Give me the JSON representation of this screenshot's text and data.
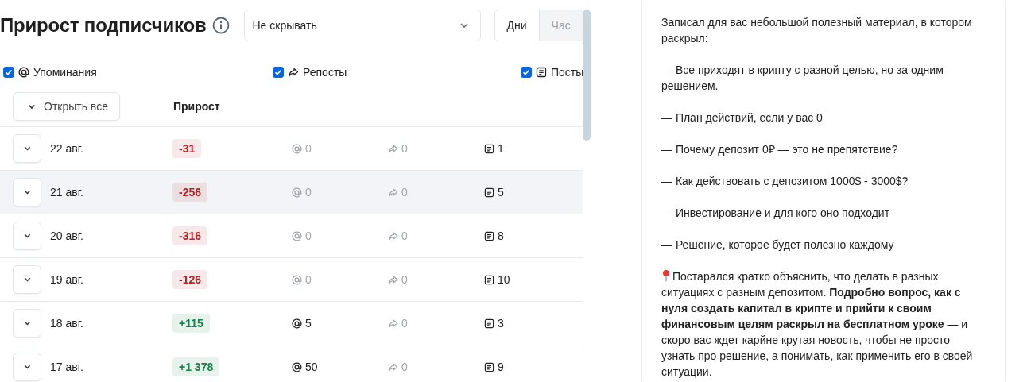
{
  "header": {
    "title": "Прирост подписчиков",
    "filter": {
      "value": "Не скрывать"
    },
    "periods": [
      {
        "label": "Дни",
        "selected": true
      },
      {
        "label": "Час",
        "selected": false
      }
    ]
  },
  "toggles": [
    {
      "label": "Упоминания",
      "checked": true,
      "kind": "mention"
    },
    {
      "label": "Репосты",
      "checked": true,
      "kind": "repost"
    },
    {
      "label": "Посты",
      "checked": true,
      "kind": "post"
    }
  ],
  "table": {
    "expand_all": "Открыть все",
    "columns": [
      "Прирост"
    ],
    "rows": [
      {
        "date": "22 авг.",
        "growth": "-31",
        "color": "#b42323",
        "mentions": {
          "text": "0",
          "dim": true
        },
        "reposts": {
          "text": "0",
          "dim": true
        },
        "posts": {
          "text": "1",
          "dim": false
        },
        "highlighted": false
      },
      {
        "date": "21 авг.",
        "growth": "-256",
        "color": "#b42323",
        "mentions": {
          "text": "0",
          "dim": true
        },
        "reposts": {
          "text": "0",
          "dim": true
        },
        "posts": {
          "text": "5",
          "dim": false
        },
        "highlighted": true
      },
      {
        "date": "20 авг.",
        "growth": "-316",
        "color": "#b42323",
        "mentions": {
          "text": "0",
          "dim": true
        },
        "reposts": {
          "text": "0",
          "dim": true
        },
        "posts": {
          "text": "8",
          "dim": false
        },
        "highlighted": false
      },
      {
        "date": "19 авг.",
        "growth": "-126",
        "color": "#b42323",
        "mentions": {
          "text": "0",
          "dim": true
        },
        "reposts": {
          "text": "0",
          "dim": true
        },
        "posts": {
          "text": "10",
          "dim": false
        },
        "highlighted": false
      },
      {
        "date": "18 авг.",
        "growth": "+115",
        "color": "#14804a",
        "mentions": {
          "text": "5",
          "dim": false
        },
        "reposts": {
          "text": "0",
          "dim": true
        },
        "posts": {
          "text": "3",
          "dim": false
        },
        "highlighted": false
      },
      {
        "date": "17 авг.",
        "growth": "+1 378",
        "color": "#14804a",
        "mentions": {
          "text": "50",
          "dim": false
        },
        "reposts": {
          "text": "0",
          "dim": true
        },
        "posts": {
          "text": "9",
          "dim": false
        },
        "highlighted": false
      }
    ]
  },
  "post": {
    "paragraphs": [
      {
        "text": "Записал для вас небольшой полезный материал, в котором раскрыл:",
        "pinned": false
      },
      {
        "text": "— Все приходят в крипту с разной целью, но за одним решением.",
        "pinned": false
      },
      {
        "text": "— План действий, если у вас 0",
        "pinned": false
      },
      {
        "text": "— Почему депозит 0₽ — это не препятствие?",
        "pinned": false
      },
      {
        "text": "— Как действовать с депозитом 1000$ - 3000$?",
        "pinned": false
      },
      {
        "text": "— Инвестирование и для кого оно подходит",
        "pinned": false
      },
      {
        "text": "— Решение, которое будет полезно каждому",
        "pinned": false
      },
      {
        "text": "Постарался кратко объяснить, что делать в разных ситуациях с разным депозитом. **Подробно вопрос, как с нуля создать капитал в крипте и прийти к своим финансовым целям раскрыл на бесплатном уроке** — и скоро вас ждет карйне крутая новость, чтобы не просто узнать про решение, а понимать, как применить его в своей ситуации.",
        "pinned": true
      }
    ]
  }
}
